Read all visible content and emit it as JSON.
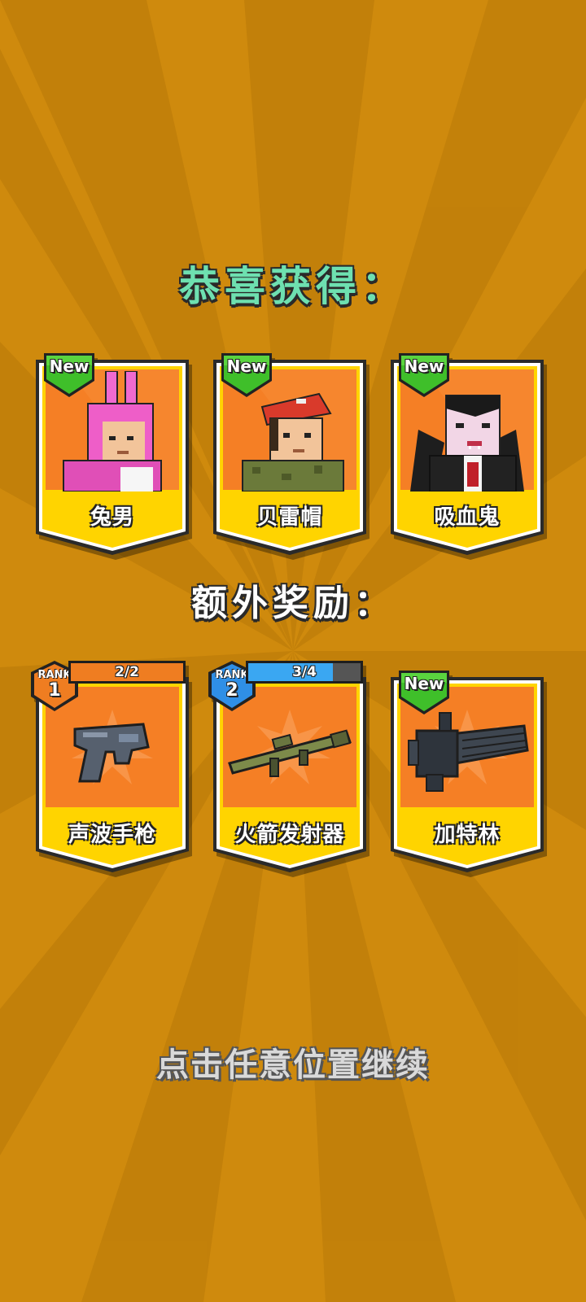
{
  "title": "恭喜获得：",
  "bonus_title": "额外奖励：",
  "continue_hint": "点击任意位置继续",
  "colors": {
    "background": "#cf8a0d",
    "card_orange": "#f57f25",
    "card_yellow": "#ffd400",
    "new_green": "#3fbf2a",
    "rank_orange": "#ef7d21",
    "rank_blue": "#2f8fe6"
  },
  "rewards": [
    {
      "name": "兔男",
      "badge": "New",
      "icon": "bunny-man-character-icon"
    },
    {
      "name": "贝雷帽",
      "badge": "New",
      "icon": "beret-soldier-character-icon"
    },
    {
      "name": "吸血鬼",
      "badge": "New",
      "icon": "vampire-character-icon"
    }
  ],
  "bonus": [
    {
      "name": "声波手枪",
      "rank_word": "RANK",
      "rank": "1",
      "progress_text": "2/2",
      "progress": 1.0,
      "icon": "sonic-pistol-icon"
    },
    {
      "name": "火箭发射器",
      "rank_word": "RANK",
      "rank": "2",
      "progress_text": "3/4",
      "progress": 0.75,
      "icon": "rocket-launcher-icon"
    },
    {
      "name": "加特林",
      "badge": "New",
      "icon": "gatling-gun-icon"
    }
  ]
}
